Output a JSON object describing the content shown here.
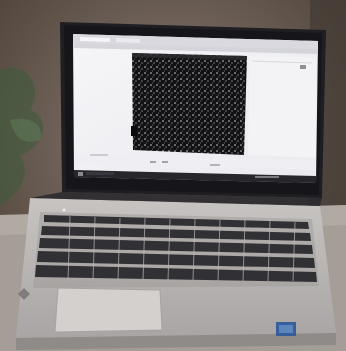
{
  "photo": {
    "subject": "laptop-with-screen-on",
    "colors": {
      "background_wall": "#7a6b60",
      "table": "#a49b93",
      "laptop_lid": "#1e1d22",
      "screen_browser_bg": "#f2f2f4",
      "screen_dark_panel": "#1a1a1d",
      "taskbar": "#26262b",
      "keyboard_deck": "#b9b6b4",
      "keys": "#2b2a2f",
      "trackpad": "#c9c6c4",
      "sticker_blue": "#2f5b9a"
    },
    "icons": [
      "browser-window-icon",
      "taskbar-start-icon",
      "keyboard-icon",
      "trackpad-icon",
      "sticker-icon"
    ]
  }
}
